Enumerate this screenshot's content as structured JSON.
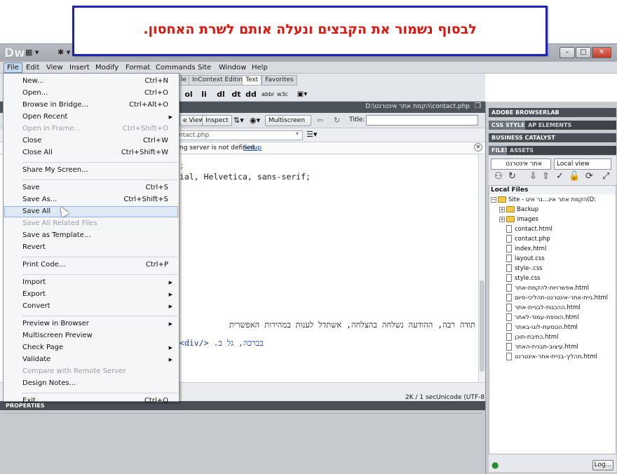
{
  "callout": {
    "text": "לבסוף נשמור את הקבצים ונעלה אותם לשרת האחסון."
  },
  "app": {
    "logo": "Dw"
  },
  "window_controls": {
    "minimize": "–",
    "maximize": "□",
    "close": "✕"
  },
  "menubar": [
    "File",
    "Edit",
    "View",
    "Insert",
    "Modify",
    "Format",
    "Commands",
    "Site",
    "Window",
    "Help"
  ],
  "insert_tabs": [
    "le",
    "InContext Editing",
    "Text",
    "Favorites"
  ],
  "insert_buttons": [
    "ol",
    "li",
    "dl",
    "dt",
    "dd",
    "abbr",
    "w3c"
  ],
  "doc_tab": {
    "path": "D:\\הקמת אתר אינטרנט\\contact.php"
  },
  "doc_toolbar": {
    "live_view": "e View",
    "inspect": "Inspect",
    "multiscreen": "Multiscreen",
    "title_label": "Title:",
    "title_value": ""
  },
  "address": {
    "file": "ntact.php"
  },
  "info_bar": {
    "text": "ng server is not defined.",
    "link": "Setup"
  },
  "code_lines": [
    ";",
    "ial, Helvetica, sans-serif;",
    "תודה רבה, ההודעה נשלחה בהצלחה, אשתדל לענות במהירות האפשרית",
    "בברכה, גל ב. </div>"
  ],
  "status": {
    "size": "2K / 1 sec",
    "encoding": "Unicode (UTF-8"
  },
  "properties": {
    "title": "PROPERTIES"
  },
  "panels": {
    "browserlab": "ADOBE BROWSERLAB",
    "css_tabs": [
      "CSS STYLES",
      "AP ELEMENTS"
    ],
    "business": "BUSINESS CATALYST",
    "files_tabs": [
      "FILES",
      "ASSETS"
    ],
    "site_select": "אתר אינטרנט",
    "view_select": "Local view",
    "local_files": "Local Files",
    "site_root": "Site - הקמת אתר אינ...נר איט(D:",
    "log_button": "Log..."
  },
  "tree": [
    {
      "name": "Backup",
      "type": "folder"
    },
    {
      "name": "images",
      "type": "folder"
    },
    {
      "name": "contact.html",
      "type": "file"
    },
    {
      "name": "contact.php",
      "type": "file"
    },
    {
      "name": "index.html",
      "type": "file"
    },
    {
      "name": "layout.css",
      "type": "file"
    },
    {
      "name": "style-.css",
      "type": "file"
    },
    {
      "name": "style.css",
      "type": "file"
    },
    {
      "name": "אפשרויות-להקמת-אתר.html",
      "type": "file"
    },
    {
      "name": "ניית-אתר-אינטרנט-תהליכי-סיום.html",
      "type": "file"
    },
    {
      "name": "ההכנות-לבניית-אתר.html",
      "type": "file"
    },
    {
      "name": "הוספת-עמוד-לאתר.html",
      "type": "file"
    },
    {
      "name": "הטמעת-לוגו-באתר.html",
      "type": "file"
    },
    {
      "name": "כתיבת-תוכן.html",
      "type": "file"
    },
    {
      "name": "עיצוב-תבנית-האתר.html",
      "type": "file"
    },
    {
      "name": "תהליך-בניית-אתר-אינטרנט.html",
      "type": "file"
    }
  ],
  "file_menu": [
    {
      "label": "New...",
      "shortcut": "Ctrl+N"
    },
    {
      "label": "Open...",
      "shortcut": "Ctrl+O"
    },
    {
      "label": "Browse in Bridge...",
      "shortcut": "Ctrl+Alt+O"
    },
    {
      "label": "Open Recent",
      "submenu": true
    },
    {
      "label": "Open in Frame...",
      "shortcut": "Ctrl+Shift+O",
      "disabled": true
    },
    {
      "label": "Close",
      "shortcut": "Ctrl+W"
    },
    {
      "label": "Close All",
      "shortcut": "Ctrl+Shift+W"
    },
    {
      "separator": true
    },
    {
      "label": "Share My Screen..."
    },
    {
      "separator": true
    },
    {
      "label": "Save",
      "shortcut": "Ctrl+S"
    },
    {
      "label": "Save As...",
      "shortcut": "Ctrl+Shift+S"
    },
    {
      "label": "Save All",
      "hover": true
    },
    {
      "label": "Save All Related Files",
      "disabled": true
    },
    {
      "label": "Save as Template..."
    },
    {
      "label": "Revert"
    },
    {
      "separator": true
    },
    {
      "label": "Print Code...",
      "shortcut": "Ctrl+P"
    },
    {
      "separator": true
    },
    {
      "label": "Import",
      "submenu": true
    },
    {
      "label": "Export",
      "submenu": true
    },
    {
      "label": "Convert",
      "submenu": true
    },
    {
      "separator": true
    },
    {
      "label": "Preview in Browser",
      "submenu": true
    },
    {
      "label": "Multiscreen Preview"
    },
    {
      "label": "Check Page",
      "submenu": true
    },
    {
      "label": "Validate",
      "submenu": true
    },
    {
      "label": "Compare with Remote Server",
      "disabled": true
    },
    {
      "label": "Design Notes..."
    },
    {
      "separator": true
    },
    {
      "label": "Exit",
      "shortcut": "Ctrl+Q"
    }
  ],
  "colors": {
    "callout_border": "#1b22b5",
    "callout_text": "#d8170f",
    "menu_hover": "#dfe9f6"
  }
}
